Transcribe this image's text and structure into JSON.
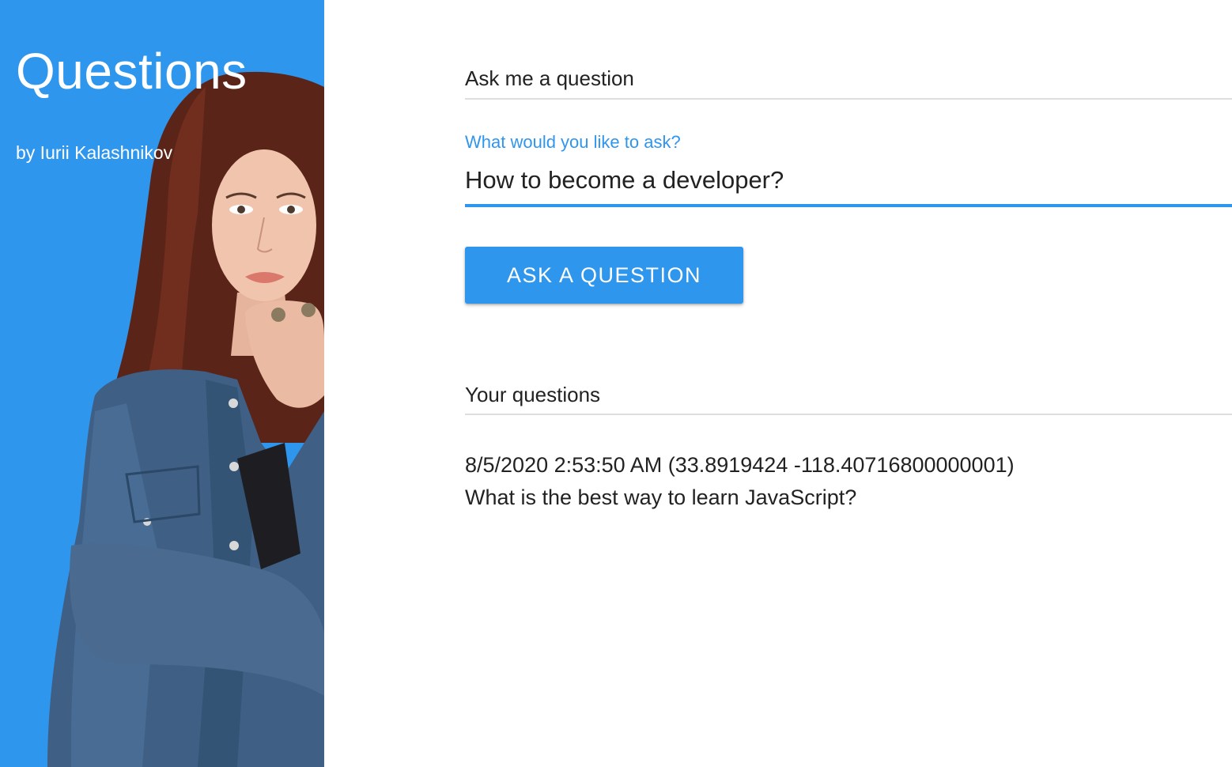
{
  "colors": {
    "accent": "#2f96ee",
    "sidebar_bg": "#2f96ee",
    "sidebar_text": "#ffffff",
    "divider": "#dedede",
    "text": "#222222"
  },
  "sidebar": {
    "title": "Questions",
    "subtitle": "by Iurii Kalashnikov",
    "image_icon": "portrait-photo"
  },
  "ask_section": {
    "heading": "Ask me a question",
    "field_label": "What would you like to ask?",
    "input_value": "How to become a developer?",
    "button_label": "ASK A QUESTION"
  },
  "questions_section": {
    "heading": "Your questions",
    "items": [
      {
        "meta": "8/5/2020 2:53:50 AM (33.8919424 -118.40716800000001)",
        "text": "What is the best way to learn JavaScript?"
      }
    ]
  }
}
